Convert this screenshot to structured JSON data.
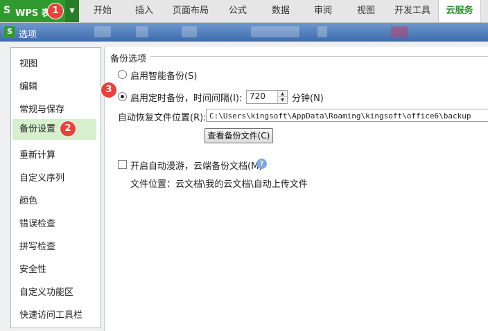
{
  "topbar": {
    "app_logo": "S",
    "app_name": "WPS 表",
    "dropdown_glyph": "▼",
    "tabs": [
      "开始",
      "插入",
      "页面布局",
      "公式",
      "数据",
      "审阅",
      "视图",
      "开发工具",
      "云服务"
    ],
    "active_tab": "云服务",
    "accent": "#2f9b2f"
  },
  "dialog": {
    "title_icon": "S",
    "title": "选项"
  },
  "badges": [
    "1",
    "2",
    "3"
  ],
  "sidebar": {
    "items": [
      "视图",
      "编辑",
      "常规与保存",
      "备份设置",
      "重新计算",
      "自定义序列",
      "颜色",
      "错误检查",
      "拼写检查",
      "安全性",
      "自定义功能区",
      "快速访问工具栏"
    ],
    "selected": "备份设置",
    "selected_color": "#d6efcc"
  },
  "backup": {
    "group_title": "备份选项",
    "smart_backup_label": "启用智能备份(S)",
    "timed_backup_label": "启用定时备份，时间间隔(I):",
    "interval_value": "720",
    "interval_unit": "分钟(N)",
    "recover_path_label": "自动恢复文件位置(R):",
    "recover_path_value": "C:\\Users\\kingsoft\\AppData\\Roaming\\kingsoft\\office6\\backup",
    "view_backup_button": "查看备份文件(C)",
    "cloud_roam_label": "开启自动漫游，云端备份文档(M)",
    "cloud_location_text": "文件位置：云文档\\我的云文档\\自动上传文件"
  }
}
